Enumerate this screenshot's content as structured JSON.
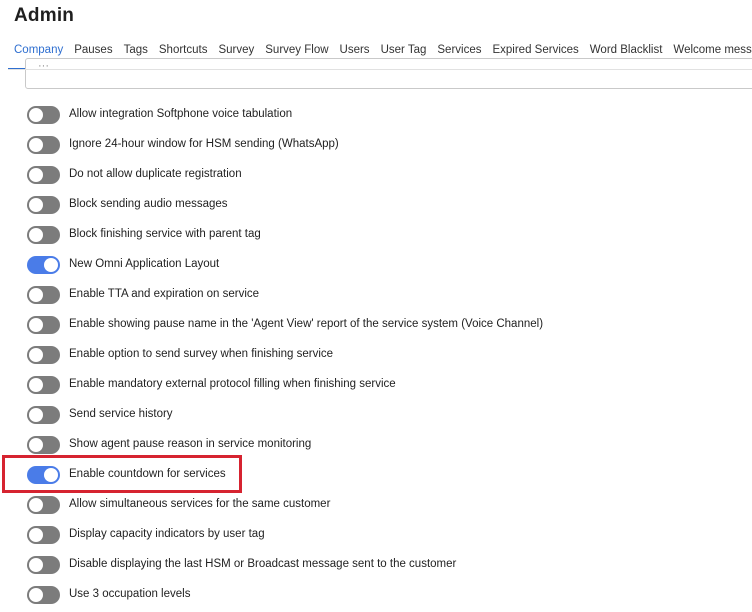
{
  "page": {
    "title": "Admin"
  },
  "tabs": [
    {
      "label": "Company",
      "active": true
    },
    {
      "label": "Pauses"
    },
    {
      "label": "Tags"
    },
    {
      "label": "Shortcuts"
    },
    {
      "label": "Survey"
    },
    {
      "label": "Survey Flow"
    },
    {
      "label": "Users"
    },
    {
      "label": "User Tag"
    },
    {
      "label": "Services"
    },
    {
      "label": "Expired Services"
    },
    {
      "label": "Word Blacklist"
    },
    {
      "label": "Welcome message"
    }
  ],
  "partial_field": {
    "value": "···"
  },
  "settings": [
    {
      "label": "Allow integration Softphone voice tabulation",
      "enabled": false
    },
    {
      "label": "Ignore 24-hour window for HSM sending (WhatsApp)",
      "enabled": false
    },
    {
      "label": "Do not allow duplicate registration",
      "enabled": false
    },
    {
      "label": "Block sending audio messages",
      "enabled": false
    },
    {
      "label": "Block finishing service with parent tag",
      "enabled": false
    },
    {
      "label": "New Omni Application Layout",
      "enabled": true
    },
    {
      "label": "Enable TTA and expiration on service",
      "enabled": false
    },
    {
      "label": "Enable showing pause name in the 'Agent View' report of the service system (Voice Channel)",
      "enabled": false
    },
    {
      "label": "Enable option to send survey when finishing service",
      "enabled": false
    },
    {
      "label": "Enable mandatory external protocol filling when finishing service",
      "enabled": false
    },
    {
      "label": "Send service history",
      "enabled": false
    },
    {
      "label": "Show agent pause reason in service monitoring",
      "enabled": false
    },
    {
      "label": "Enable countdown for services",
      "enabled": true,
      "highlighted": true
    },
    {
      "label": "Allow simultaneous services for the same customer",
      "enabled": false
    },
    {
      "label": "Display capacity indicators by user tag",
      "enabled": false
    },
    {
      "label": "Disable displaying the last HSM or Broadcast message sent to the customer",
      "enabled": false
    },
    {
      "label": "Use 3 occupation levels",
      "enabled": false
    }
  ],
  "colors": {
    "accent": "#2f6fd0",
    "toggle_on": "#4a7ce8",
    "toggle_off": "#7c7c7c",
    "highlight": "#d62330"
  }
}
